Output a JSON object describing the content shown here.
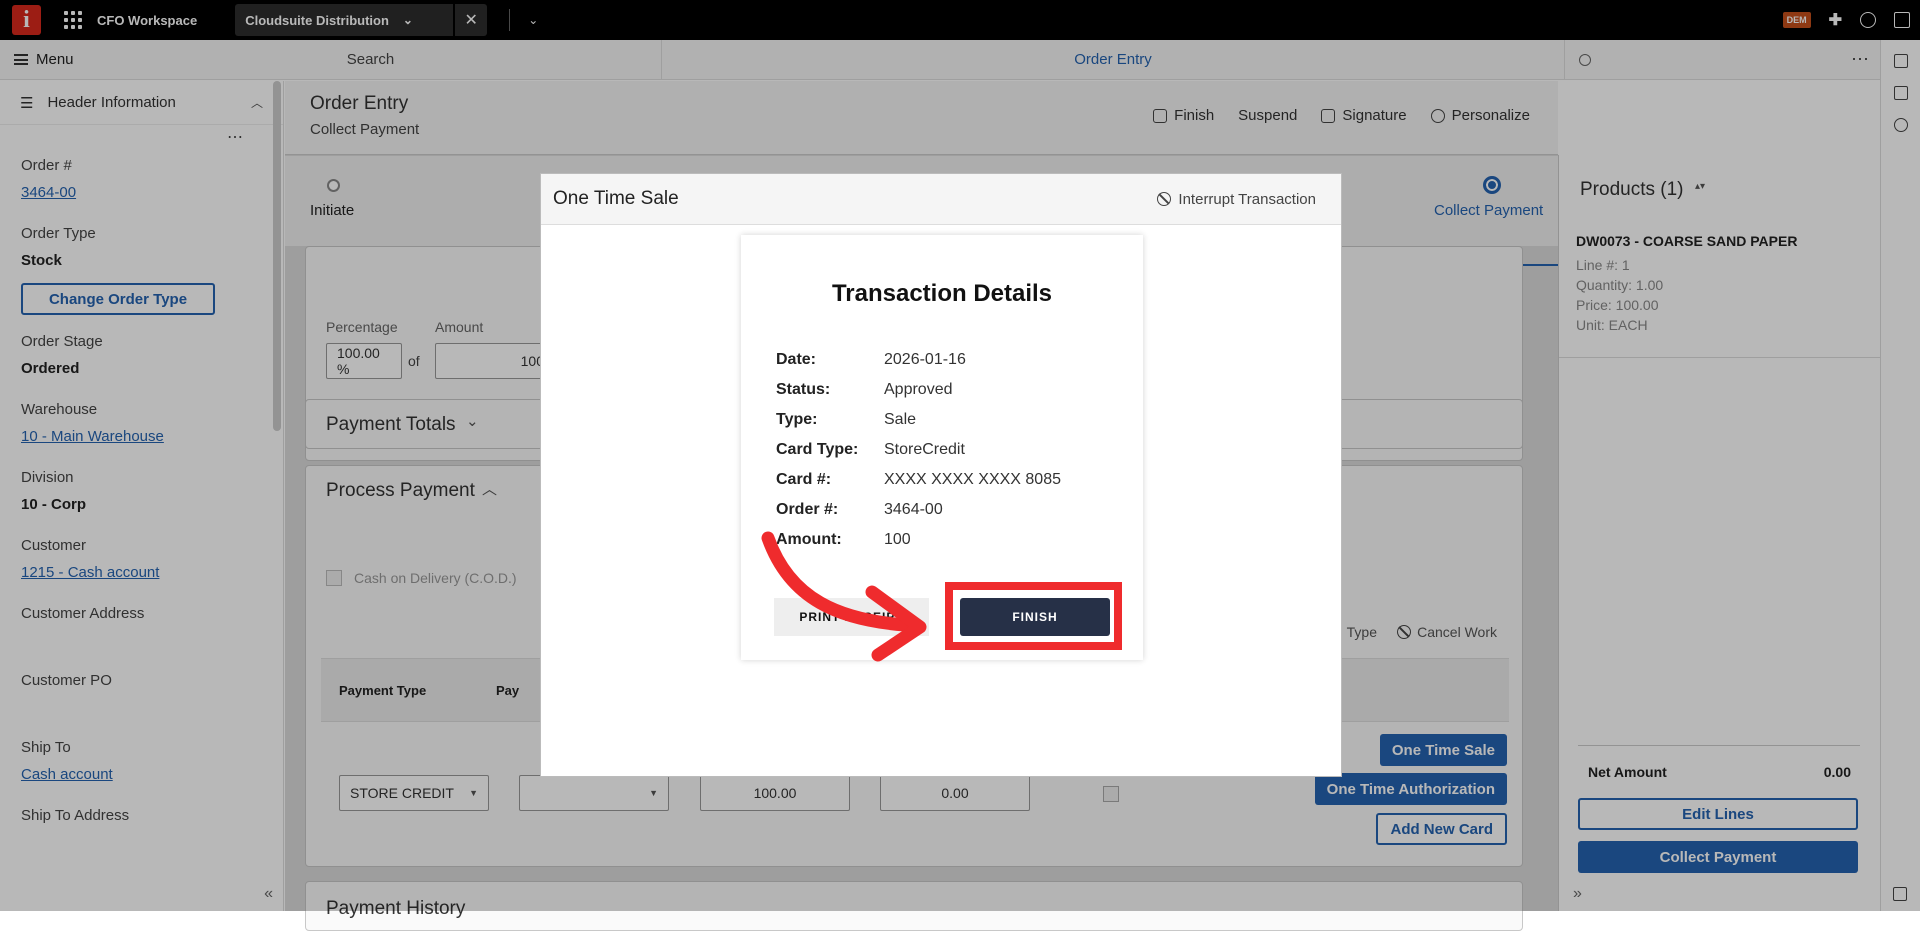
{
  "topbar": {
    "workspace": "CFO Workspace",
    "tab_label": "Cloudsuite Distribution",
    "env_badge": "DEM",
    "logo_letter": "i"
  },
  "nav": {
    "menu_label": "Menu",
    "search_label": "Search",
    "active_label": "Order Entry"
  },
  "sidebar": {
    "title": "Header Information",
    "fields": {
      "order_label": "Order #",
      "order_value": "3464-00",
      "order_type_label": "Order Type",
      "order_type_value": "Stock",
      "change_order_type": "Change Order Type",
      "order_stage_label": "Order Stage",
      "order_stage_value": "Ordered",
      "warehouse_label": "Warehouse",
      "warehouse_value": "10 - Main Warehouse",
      "division_label": "Division",
      "division_value": "10 - Corp",
      "customer_label": "Customer",
      "customer_value": "1215 - Cash account",
      "customer_address_label": "Customer Address",
      "customer_po_label": "Customer PO",
      "ship_to_label": "Ship To",
      "ship_to_value": "Cash account",
      "ship_to_address_label": "Ship To Address"
    }
  },
  "page": {
    "title": "Order Entry",
    "subtitle": "Collect Payment",
    "actions": {
      "finish": "Finish",
      "suspend": "Suspend",
      "signature": "Signature",
      "personalize": "Personalize"
    },
    "steps": {
      "first": "Initiate",
      "last": "Collect Payment"
    },
    "payment_input": {
      "percentage_label": "Percentage",
      "percentage_value": "100.00 %",
      "of_label": "of",
      "amount_label": "Amount",
      "amount_value": "100"
    },
    "payment_totals_title": "Payment Totals",
    "process_payment": {
      "title": "Process Payment",
      "cod_label": "Cash on Delivery (C.O.D.)",
      "payment_type_header": "Payment Type",
      "payment_header_2": "Pay",
      "type_action": "Type",
      "cancel_work": "Cancel Work",
      "row": {
        "payment_type": "STORE CREDIT",
        "amount": "100.00",
        "other": "0.00"
      },
      "one_time_sale": "One Time Sale",
      "one_time_auth": "One Time Authorization",
      "add_new_card": "Add New Card"
    },
    "payment_history_title": "Payment History"
  },
  "products": {
    "title": "Products (1)",
    "item_name": "DW0073 - COARSE SAND PAPER",
    "line": "Line #: 1",
    "quantity": "Quantity: 1.00",
    "price": "Price: 100.00",
    "unit": "Unit: EACH",
    "net_amount_label": "Net Amount",
    "net_amount_value": "0.00",
    "edit_lines": "Edit Lines",
    "collect_payment": "Collect Payment"
  },
  "modal": {
    "title": "One Time Sale",
    "interrupt": "Interrupt Transaction",
    "tx_title": "Transaction Details",
    "rows": [
      {
        "label": "Date:",
        "value": "2026-01-16"
      },
      {
        "label": "Status:",
        "value": "Approved"
      },
      {
        "label": "Type:",
        "value": "Sale"
      },
      {
        "label": "Card Type:",
        "value": "StoreCredit"
      },
      {
        "label": "Card #:",
        "value": "XXXX XXXX XXXX 8085"
      },
      {
        "label": "Order #:",
        "value": "3464-00"
      },
      {
        "label": "Amount:",
        "value": "100"
      }
    ],
    "print_receipt": "PRINT RECEIPT",
    "finish": "FINISH"
  },
  "colors": {
    "accent": "#2563b0",
    "finish_button": "#263047",
    "annotation": "#ef2b2d",
    "logo": "#d9291c"
  }
}
